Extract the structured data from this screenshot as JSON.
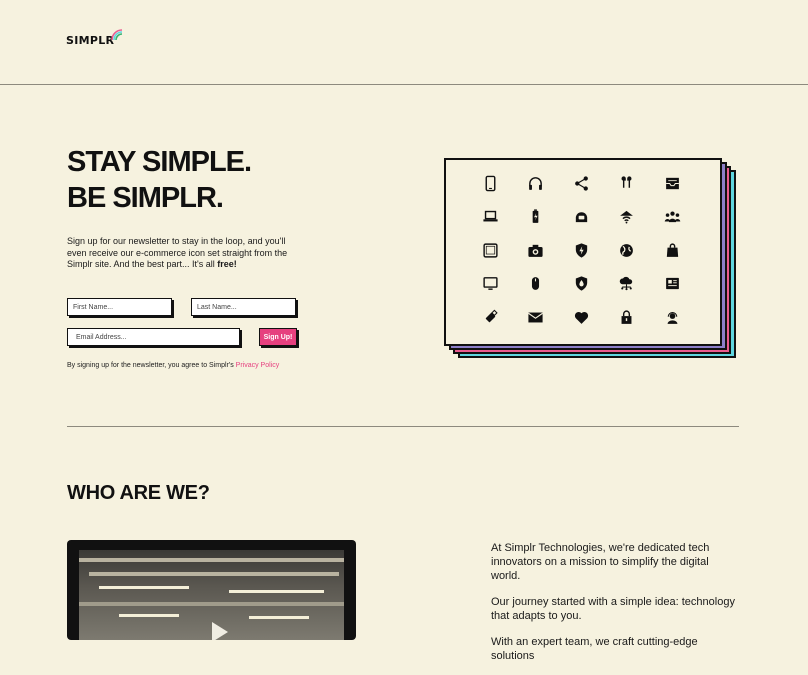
{
  "header": {
    "logo_text": "SIMPLR"
  },
  "hero": {
    "title_line1": "STAY SIMPLE.",
    "title_line2": "BE SIMPLR.",
    "description": "Sign up for our newsletter to stay in the loop, and you'll even receive our e-commerce icon set straight from the Simplr site. And the best part... It's all ",
    "description_bold": "free!",
    "form": {
      "first_name_placeholder": "First Name...",
      "last_name_placeholder": "Last Name...",
      "email_placeholder": "Email Address...",
      "submit_label": "Sign Up!"
    },
    "legal_text": "By signing up for the newsletter, you agree to Simplr's ",
    "legal_link": "Privacy Policy"
  },
  "icon_set": [
    "smartphone-icon",
    "headphones-icon",
    "share-icon",
    "earbuds-icon",
    "inbox-icon",
    "laptop-icon",
    "battery-charging-icon",
    "helmet-icon",
    "wifi-router-icon",
    "group-icon",
    "tablet-icon",
    "camera-icon",
    "shield-bolt-icon",
    "globe-icon",
    "shopping-bag-icon",
    "monitor-icon",
    "mouse-icon",
    "shield-drop-icon",
    "cloud-network-icon",
    "newspaper-icon",
    "usb-icon",
    "mail-icon",
    "heart-icon",
    "lock-icon",
    "support-agent-icon"
  ],
  "about": {
    "title": "WHO ARE WE?",
    "paragraph1": "At Simplr Technologies, we're dedicated tech innovators on a mission to simplify the digital world.",
    "paragraph2": "Our journey started with a simple idea: technology that adapts to you.",
    "paragraph3": "With an expert team, we craft cutting-edge solutions"
  },
  "colors": {
    "background": "#f6f2df",
    "accent_pink": "#e6407f",
    "accent_cyan": "#5fd6e0",
    "accent_purple": "#8d7fc9"
  }
}
